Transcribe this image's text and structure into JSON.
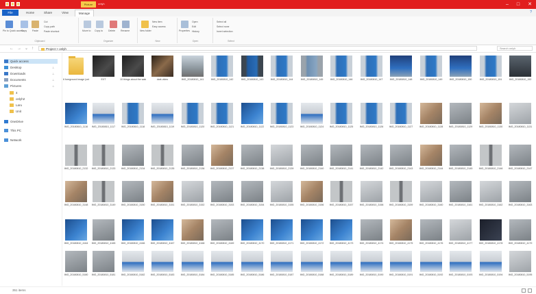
{
  "titlebar": {
    "context_tab": "Picture Tools",
    "window_title": "onlyh",
    "controls": [
      "–",
      "□",
      "✕"
    ]
  },
  "tabs": [
    {
      "label": "File",
      "kind": "file"
    },
    {
      "label": "Home",
      "kind": "normal"
    },
    {
      "label": "Share",
      "kind": "normal"
    },
    {
      "label": "View",
      "kind": "normal"
    },
    {
      "label": "Manage",
      "kind": "active"
    }
  ],
  "ribbon": {
    "groups": [
      {
        "caption": "Clipboard",
        "buttons": [
          "Pin to Quick access",
          "Copy",
          "Paste"
        ],
        "small": [
          "Cut",
          "Copy path",
          "Paste shortcut"
        ]
      },
      {
        "caption": "Organize",
        "buttons": [
          "Move to",
          "Copy to",
          "Delete",
          "Rename"
        ],
        "small": []
      },
      {
        "caption": "New",
        "buttons": [
          "New folder"
        ],
        "small": [
          "New item",
          "Easy access"
        ]
      },
      {
        "caption": "Open",
        "buttons": [
          "Properties"
        ],
        "small": [
          "Open",
          "Edit",
          "History"
        ]
      },
      {
        "caption": "Select",
        "buttons": [],
        "small": [
          "Select all",
          "Select none",
          "Invert selection"
        ]
      }
    ]
  },
  "address": {
    "path": "Project  >  onlyh",
    "search_placeholder": "Search onlyh"
  },
  "sidebar": {
    "items": [
      {
        "label": "Quick access",
        "icon": "star-icon",
        "selected": true
      },
      {
        "label": "Desktop",
        "icon": "desktop-icon",
        "pin": true
      },
      {
        "label": "Downloads",
        "icon": "download-icon",
        "pin": true
      },
      {
        "label": "Documents",
        "icon": "document-icon",
        "pin": true
      },
      {
        "label": "Pictures",
        "icon": "pictures-icon",
        "pin": true
      },
      {
        "label": "4",
        "icon": "folder-icon"
      },
      {
        "label": "onlyh2",
        "icon": "folder-icon"
      },
      {
        "label": "Laru",
        "icon": "folder-icon"
      },
      {
        "label": "Unit",
        "icon": "folder-icon"
      },
      {
        "label": "OneDrive",
        "icon": "cloud-icon"
      },
      {
        "label": "This PC",
        "icon": "pc-icon"
      },
      {
        "label": "Network",
        "icon": "network-icon"
      }
    ]
  },
  "files": {
    "row1": [
      {
        "name": "6 foreground image (onlyh)",
        "kind": "folder"
      },
      {
        "name": "EXT",
        "kind": "image",
        "color": "video-dark"
      },
      {
        "name": "10 things about the water",
        "kind": "image",
        "color": "video-dark"
      },
      {
        "name": "dark video",
        "kind": "image",
        "color": "video-warm"
      },
      {
        "name": "IMG_20180810_141",
        "kind": "image",
        "color": "street"
      },
      {
        "name": "IMG_20180810_142",
        "kind": "image",
        "color": "banner"
      },
      {
        "name": "IMG_20180810_143",
        "kind": "image",
        "color": "banner-dark"
      },
      {
        "name": "IMG_20180810_144",
        "kind": "image",
        "color": "banner"
      },
      {
        "name": "IMG_20180810_145",
        "kind": "image",
        "color": "banner-gray"
      },
      {
        "name": "IMG_20180810_146",
        "kind": "image",
        "color": "banner"
      },
      {
        "name": "IMG_20180810_147",
        "kind": "image",
        "color": "banner"
      },
      {
        "name": "IMG_20180810_148",
        "kind": "image",
        "color": "banner-wide"
      },
      {
        "name": "IMG_20180810_149",
        "kind": "image",
        "color": "banner"
      },
      {
        "name": "IMG_20180810_150",
        "kind": "image",
        "color": "banner-wide"
      },
      {
        "name": "IMG_20180810_151",
        "kind": "image",
        "color": "banner"
      },
      {
        "name": "IMG_20180810_152",
        "kind": "image",
        "color": "floor-dark"
      }
    ]
  },
  "statusbar": {
    "count": "351 items"
  }
}
